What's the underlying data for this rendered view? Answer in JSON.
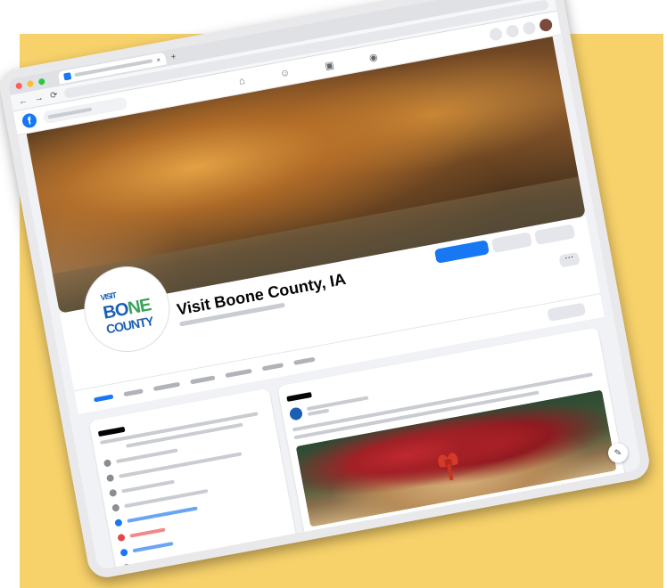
{
  "browser": {
    "tab_close": "×",
    "new_tab": "+",
    "back": "←",
    "forward": "→",
    "reload": "⟳"
  },
  "facebook": {
    "logo_letter": "f",
    "nav_icons": [
      "home-icon",
      "friends-icon",
      "marketplace-icon",
      "groups-icon"
    ],
    "nav_glyphs": [
      "⌂",
      "☺",
      "▣",
      "◉"
    ]
  },
  "page": {
    "name": "Visit Boone County, IA"
  },
  "profile_logo": {
    "line1": "VISIT",
    "line2a": "BO",
    "line2b": "NE",
    "line3": "COUNTY"
  },
  "actions": {
    "more_label": "···"
  },
  "chat_fab_icon": "✎",
  "colors": {
    "facebook_blue": "#1877f2",
    "background_yellow": "#f7d16a"
  }
}
